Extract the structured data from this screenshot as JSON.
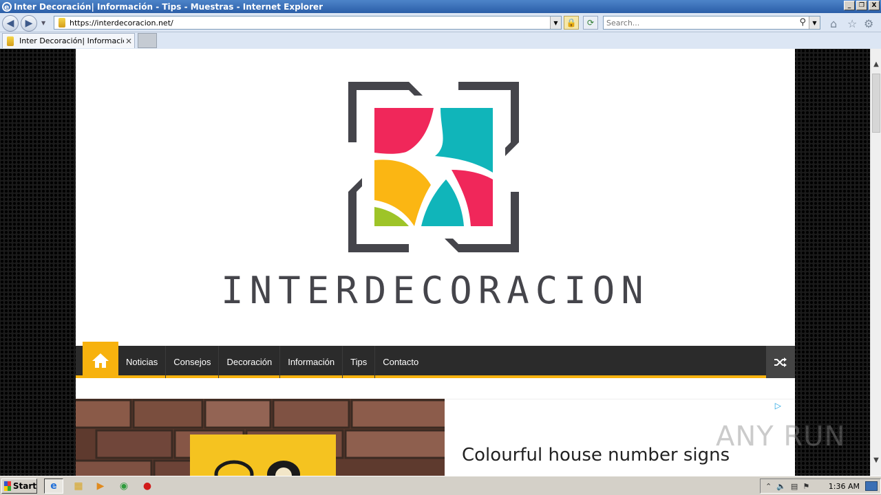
{
  "window": {
    "title": "Inter Decoración| Información - Tips - Muestras - Internet Explorer",
    "buttons": {
      "minimize": "_",
      "restore": "❐",
      "close": "X"
    }
  },
  "address_bar": {
    "url": "https://interdecoracion.net/",
    "search_placeholder": "Search..."
  },
  "tabs": [
    {
      "label": "Inter Decoración| Informació..."
    }
  ],
  "site": {
    "brand": "INTERDECORACION",
    "menu": [
      "Noticias",
      "Consejos",
      "Decoración",
      "Información",
      "Tips",
      "Contacto"
    ],
    "colors": {
      "accent": "#f7b20e",
      "menu_bg": "#2b2b2b"
    },
    "logo_colors": {
      "red": "#f0275a",
      "teal": "#10b5ba",
      "yellow": "#fbb613",
      "green": "#9ec428",
      "frame": "#45454b"
    }
  },
  "ad": {
    "headline": "Colourful house number signs",
    "choice_icon": "▷"
  },
  "watermark": "ANY RUN",
  "taskbar": {
    "start_label": "Start",
    "clock": "1:36 AM"
  }
}
